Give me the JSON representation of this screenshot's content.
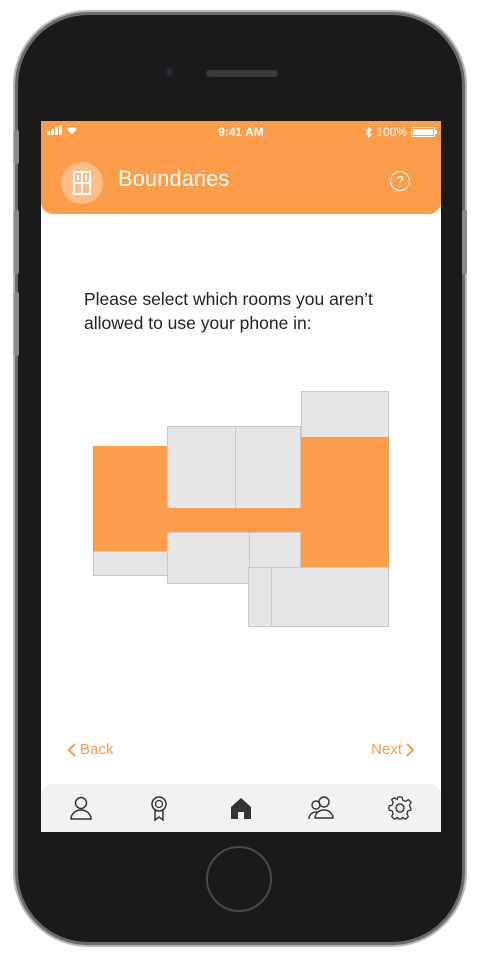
{
  "status_bar": {
    "time": "9:41 AM",
    "battery": "100%",
    "icons": [
      "signal-icon",
      "wifi-icon",
      "bluetooth-icon",
      "battery-icon"
    ]
  },
  "header": {
    "title": "Boundaries",
    "icon": "door-icon",
    "help_icon": "help-icon",
    "help_label": "?"
  },
  "prompt": "Please select which rooms you aren’t allowed to use your phone in:",
  "floor_plan": {
    "rooms": [
      {
        "id": "left-room",
        "selected": true
      },
      {
        "id": "left-strip",
        "selected": false
      },
      {
        "id": "top-middle-left",
        "selected": false
      },
      {
        "id": "top-middle-right",
        "selected": false
      },
      {
        "id": "center-hall",
        "selected": true
      },
      {
        "id": "lower-middle-left",
        "selected": false
      },
      {
        "id": "lower-middle-right",
        "selected": false
      },
      {
        "id": "top-right",
        "selected": false
      },
      {
        "id": "right-room",
        "selected": true
      },
      {
        "id": "bottom-small",
        "selected": false
      },
      {
        "id": "bottom-right",
        "selected": false
      }
    ]
  },
  "navigation": {
    "back_label": "Back",
    "next_label": "Next"
  },
  "tab_bar": {
    "items": [
      "profile-icon",
      "award-icon",
      "home-icon",
      "group-icon",
      "settings-icon"
    ],
    "active": "home-icon"
  },
  "colors": {
    "accent": "#fd9c4b",
    "room_fill": "#e6e6e6",
    "room_border": "#c8c8c8",
    "text": "#222222",
    "tab_bar": "#f2f2f2"
  }
}
